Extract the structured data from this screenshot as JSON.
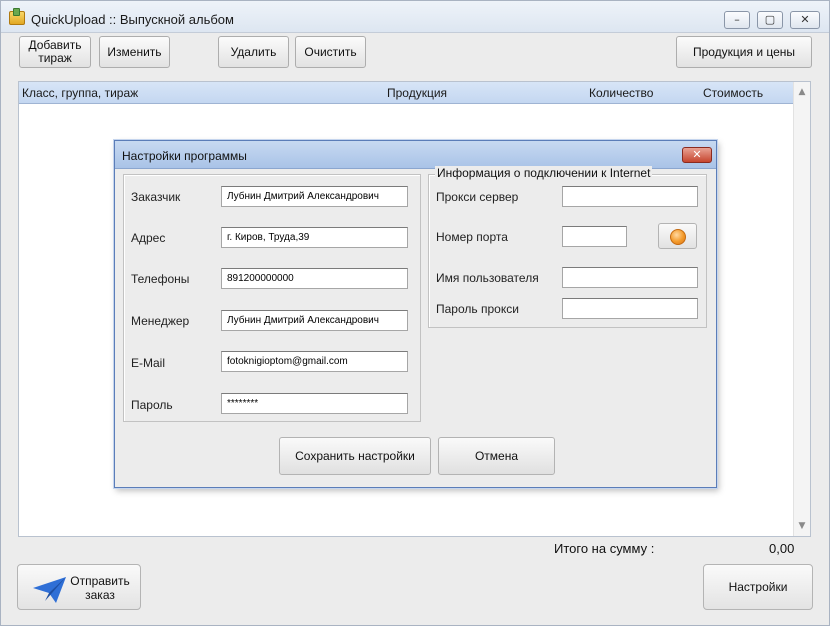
{
  "window": {
    "title": "QuickUpload :: Выпускной альбом",
    "controls": {
      "minimize": "–",
      "maximize": "▢",
      "close": "✕"
    }
  },
  "toolbar": {
    "add_label": "Добавить тираж",
    "edit_label": "Изменить",
    "delete_label": "Удалить",
    "clear_label": "Очистить",
    "products_label": "Продукция и цены"
  },
  "table": {
    "columns": [
      "Класс, группа, тираж",
      "Продукция",
      "Количество",
      "Стоимость"
    ],
    "rows": []
  },
  "footer": {
    "total_label": "Итого на сумму :",
    "total_value": "0,00",
    "send_label": "Отправить заказ",
    "settings_label": "Настройки"
  },
  "dialog": {
    "title": "Настройки программы",
    "close": "✕",
    "customer": {
      "fields": [
        {
          "label": "Заказчик",
          "value": "Лубнин Дмитрий Александрович"
        },
        {
          "label": "Адрес",
          "value": "г. Киров, Труда,39"
        },
        {
          "label": "Телефоны",
          "value": "891200000000"
        },
        {
          "label": "Менеджер",
          "value": "Лубнин Дмитрий Александрович"
        },
        {
          "label": "E-Mail",
          "value": "fotoknigioptom@gmail.com"
        },
        {
          "label": "Пароль",
          "value": "********"
        }
      ]
    },
    "internet": {
      "legend": "Информация о подключении к Internet",
      "fields": [
        {
          "label": "Прокси сервер",
          "value": ""
        },
        {
          "label": "Номер порта",
          "value": ""
        },
        {
          "label": "Имя пользователя",
          "value": ""
        },
        {
          "label": "Пароль прокси",
          "value": ""
        }
      ]
    },
    "save_label": "Сохранить настройки",
    "cancel_label": "Отмена"
  },
  "colors": {
    "header_bg": "#c4d7f1",
    "dialog_border": "#5b7db8",
    "send_icon": "#2f6fd6",
    "test_icon": "#f39a2a"
  },
  "icons": {
    "app": "app-icon",
    "send": "paper-plane-icon",
    "test_connection": "connection-test-icon"
  }
}
